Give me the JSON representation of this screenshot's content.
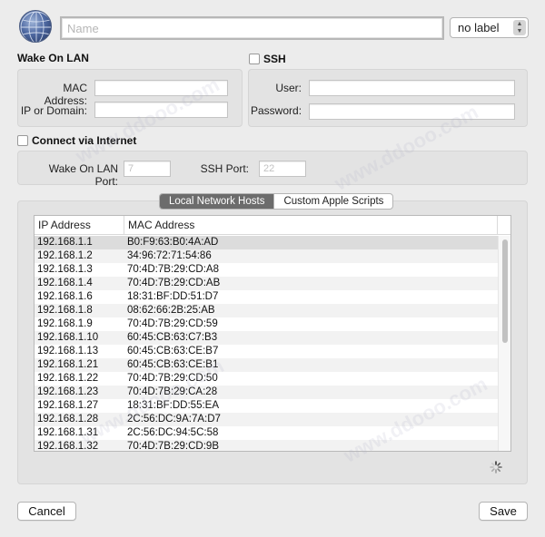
{
  "header": {
    "name_placeholder": "Name",
    "name_value": "",
    "label_select": "no label"
  },
  "wake_on_lan": {
    "title": "Wake On LAN",
    "mac_label": "MAC Address:",
    "mac_value": "",
    "ip_label": "IP or Domain:",
    "ip_value": ""
  },
  "ssh": {
    "title": "SSH",
    "user_label": "User:",
    "user_value": "",
    "password_label": "Password:",
    "password_value": ""
  },
  "internet": {
    "title": "Connect via Internet",
    "wol_port_label": "Wake On LAN Port:",
    "wol_port_placeholder": "7",
    "ssh_port_label": "SSH Port:",
    "ssh_port_placeholder": "22"
  },
  "tabs": [
    "Local Network Hosts",
    "Custom Apple Scripts"
  ],
  "table": {
    "columns": [
      "IP Address",
      "MAC Address"
    ],
    "rows": [
      [
        "192.168.1.1",
        "B0:F9:63:B0:4A:AD"
      ],
      [
        "192.168.1.2",
        "34:96:72:71:54:86"
      ],
      [
        "192.168.1.3",
        "70:4D:7B:29:CD:A8"
      ],
      [
        "192.168.1.4",
        "70:4D:7B:29:CD:AB"
      ],
      [
        "192.168.1.6",
        "18:31:BF:DD:51:D7"
      ],
      [
        "192.168.1.8",
        "08:62:66:2B:25:AB"
      ],
      [
        "192.168.1.9",
        "70:4D:7B:29:CD:59"
      ],
      [
        "192.168.1.10",
        "60:45:CB:63:C7:B3"
      ],
      [
        "192.168.1.13",
        "60:45:CB:63:CE:B7"
      ],
      [
        "192.168.1.21",
        "60:45:CB:63:CE:B1"
      ],
      [
        "192.168.1.22",
        "70:4D:7B:29:CD:50"
      ],
      [
        "192.168.1.23",
        "70:4D:7B:29:CA:28"
      ],
      [
        "192.168.1.27",
        "18:31:BF:DD:55:EA"
      ],
      [
        "192.168.1.28",
        "2C:56:DC:9A:7A:D7"
      ],
      [
        "192.168.1.31",
        "2C:56:DC:94:5C:58"
      ],
      [
        "192.168.1.32",
        "70:4D:7B:29:CD:9B"
      ]
    ]
  },
  "footer": {
    "cancel_label": "Cancel",
    "save_label": "Save"
  },
  "watermark": "www.ddooo.com"
}
